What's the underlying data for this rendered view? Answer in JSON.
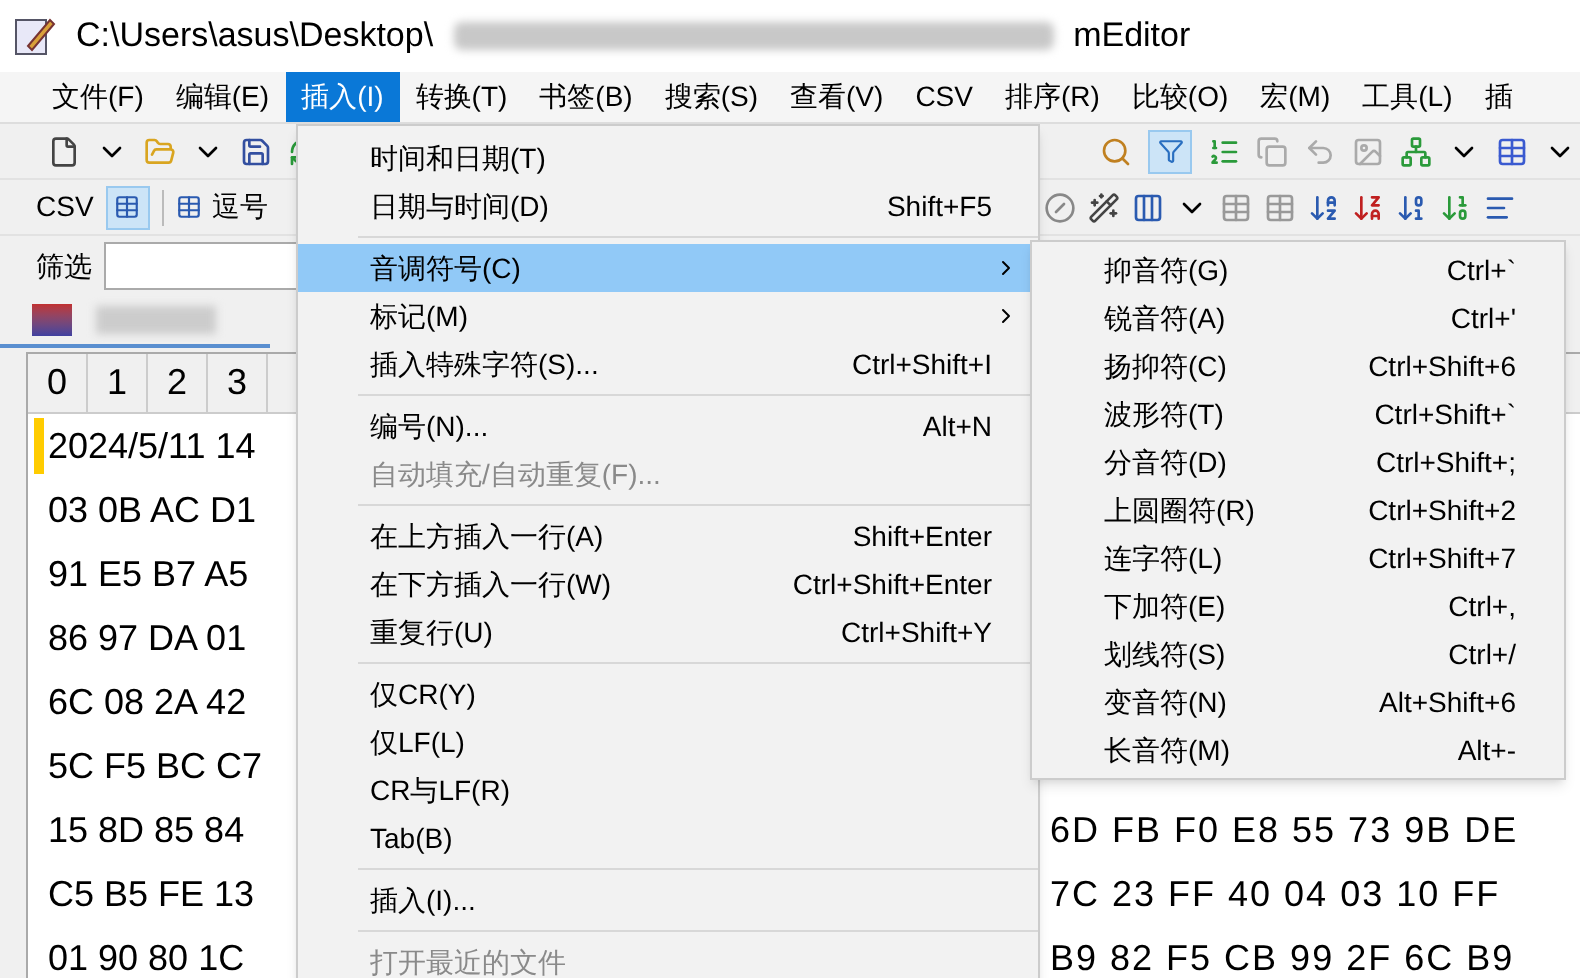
{
  "window": {
    "title_start": "C:\\Users\\asus\\Desktop\\",
    "title_end": "mEditor"
  },
  "menubar": [
    {
      "label": "文件(F)",
      "selected": false
    },
    {
      "label": "编辑(E)",
      "selected": false
    },
    {
      "label": "插入(I)",
      "selected": true
    },
    {
      "label": "转换(T)",
      "selected": false
    },
    {
      "label": "书签(B)",
      "selected": false
    },
    {
      "label": "搜索(S)",
      "selected": false
    },
    {
      "label": "查看(V)",
      "selected": false
    },
    {
      "label": "CSV",
      "selected": false
    },
    {
      "label": "排序(R)",
      "selected": false
    },
    {
      "label": "比较(O)",
      "selected": false
    },
    {
      "label": "宏(M)",
      "selected": false
    },
    {
      "label": "工具(L)",
      "selected": false
    },
    {
      "label": "插",
      "selected": false
    }
  ],
  "toolbar": {
    "csv_label": "CSV",
    "comma_label": "逗号",
    "csv_view_pressed": true,
    "filter_pressed": true
  },
  "filter": {
    "label": "筛选"
  },
  "grid": {
    "columns": [
      "0",
      "1",
      "2",
      "3"
    ],
    "rows": [
      {
        "left": "2024/5/11 14",
        "current": true
      },
      {
        "left": "03 0B AC D1",
        "current": false
      },
      {
        "left": "91 E5 B7 A5",
        "current": false
      },
      {
        "left": "86 97 DA 01",
        "current": false
      },
      {
        "left": "6C 08 2A 42",
        "current": false
      },
      {
        "left": "5C F5 BC C7",
        "current": false
      },
      {
        "left": "15 8D 85 84",
        "right": "6D FB F0 E8 55 73 9B DE",
        "current": false
      },
      {
        "left": "C5 B5 FE 13",
        "right": "7C 23 FF 40 04 03 10 FF",
        "current": false
      },
      {
        "left": "01 90 80 1C",
        "right": "B9 82 F5 CB 99 2F 6C B9",
        "current": false
      }
    ]
  },
  "insert_menu": [
    {
      "kind": "item",
      "label": "时间和日期(T)",
      "disabled": false,
      "selected": false
    },
    {
      "kind": "item",
      "label": "日期与时间(D)",
      "shortcut": "Shift+F5",
      "disabled": false,
      "selected": false
    },
    {
      "kind": "separator"
    },
    {
      "kind": "item",
      "label": "音调符号(C)",
      "submenu": true,
      "disabled": false,
      "selected": true
    },
    {
      "kind": "item",
      "label": "标记(M)",
      "submenu": true,
      "disabled": false,
      "selected": false
    },
    {
      "kind": "item",
      "label": "插入特殊字符(S)...",
      "shortcut": "Ctrl+Shift+I",
      "disabled": false,
      "selected": false
    },
    {
      "kind": "separator"
    },
    {
      "kind": "item",
      "label": "编号(N)...",
      "shortcut": "Alt+N",
      "disabled": false,
      "selected": false
    },
    {
      "kind": "item",
      "label": "自动填充/自动重复(F)...",
      "disabled": true,
      "selected": false
    },
    {
      "kind": "separator"
    },
    {
      "kind": "item",
      "label": "在上方插入一行(A)",
      "shortcut": "Shift+Enter",
      "disabled": false,
      "selected": false
    },
    {
      "kind": "item",
      "label": "在下方插入一行(W)",
      "shortcut": "Ctrl+Shift+Enter",
      "disabled": false,
      "selected": false
    },
    {
      "kind": "item",
      "label": "重复行(U)",
      "shortcut": "Ctrl+Shift+Y",
      "disabled": false,
      "selected": false
    },
    {
      "kind": "separator"
    },
    {
      "kind": "item",
      "label": "仅CR(Y)",
      "disabled": false,
      "selected": false
    },
    {
      "kind": "item",
      "label": "仅LF(L)",
      "disabled": false,
      "selected": false
    },
    {
      "kind": "item",
      "label": "CR与LF(R)",
      "disabled": false,
      "selected": false
    },
    {
      "kind": "item",
      "label": "Tab(B)",
      "disabled": false,
      "selected": false
    },
    {
      "kind": "separator"
    },
    {
      "kind": "item",
      "label": "插入(I)...",
      "disabled": false,
      "selected": false
    },
    {
      "kind": "separator"
    },
    {
      "kind": "item",
      "label": "打开最近的文件",
      "disabled": true,
      "selected": false
    }
  ],
  "accent_menu": [
    {
      "label": "抑音符(G)",
      "shortcut": "Ctrl+`"
    },
    {
      "label": "锐音符(A)",
      "shortcut": "Ctrl+'"
    },
    {
      "label": "扬抑符(C)",
      "shortcut": "Ctrl+Shift+6"
    },
    {
      "label": "波形符(T)",
      "shortcut": "Ctrl+Shift+`"
    },
    {
      "label": "分音符(D)",
      "shortcut": "Ctrl+Shift+;"
    },
    {
      "label": "上圆圈符(R)",
      "shortcut": "Ctrl+Shift+2"
    },
    {
      "label": "连字符(L)",
      "shortcut": "Ctrl+Shift+7"
    },
    {
      "label": "下加符(E)",
      "shortcut": "Ctrl+,"
    },
    {
      "label": "划线符(S)",
      "shortcut": "Ctrl+/"
    },
    {
      "label": "变音符(N)",
      "shortcut": "Alt+Shift+6"
    },
    {
      "label": "长音符(M)",
      "shortcut": "Alt+-"
    }
  ]
}
